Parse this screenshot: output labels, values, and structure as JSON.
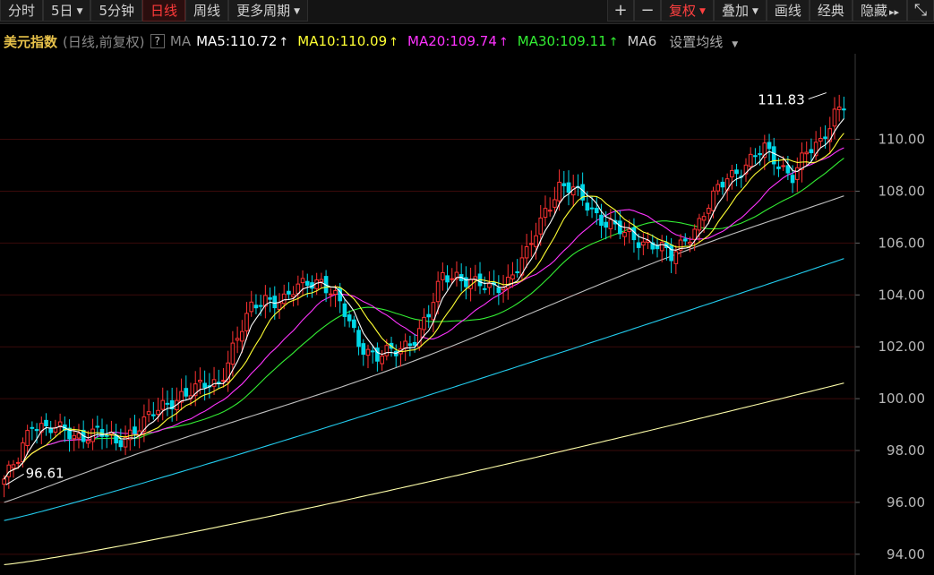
{
  "toolbar": {
    "tabs": [
      {
        "label": "分时",
        "active": false,
        "dropdown": false
      },
      {
        "label": "5日",
        "active": false,
        "dropdown": true
      },
      {
        "label": "5分钟",
        "active": false,
        "dropdown": false
      },
      {
        "label": "日线",
        "active": true,
        "dropdown": false
      },
      {
        "label": "周线",
        "active": false,
        "dropdown": false
      },
      {
        "label": "更多周期",
        "active": false,
        "dropdown": true
      }
    ],
    "zoom_in": "+",
    "zoom_out": "−",
    "adjust_label": "复权",
    "overlay_label": "叠加",
    "draw_label": "画线",
    "classic_label": "经典",
    "hide_label": "隐藏",
    "hide_arrow": "▸▸",
    "fullscreen_icon": "⤡"
  },
  "legend": {
    "name": "美元指数",
    "sub": "(日线,前复权)",
    "question": "?",
    "ma_label": "MA",
    "ma_items": [
      {
        "label": "MA5:110.72",
        "arrow": "↑",
        "color": "#ffffff"
      },
      {
        "label": "MA10:110.09",
        "arrow": "↑",
        "color": "#ffff33"
      },
      {
        "label": "MA20:109.74",
        "arrow": "↑",
        "color": "#ff33ff"
      },
      {
        "label": "MA30:109.11",
        "arrow": "↑",
        "color": "#33ee33"
      },
      {
        "label": "MA6",
        "arrow": "",
        "color": "#cccccc"
      }
    ],
    "setting": "设置均线"
  },
  "colors": {
    "up": "#ff3232",
    "down": "#00d8e8",
    "grid": "#3a0a0a",
    "ma5": "#ffffff",
    "ma10": "#ffff33",
    "ma20": "#ff33ff",
    "ma30": "#33ee33",
    "ma60": "#c0c0c0",
    "ma120": "#22ccee",
    "ma250": "#ffffaa"
  },
  "chart_data": {
    "type": "candlestick",
    "title": "美元指数",
    "ylim": [
      93.2,
      113.3
    ],
    "y_ticks": [
      94.0,
      96.0,
      98.0,
      100.0,
      102.0,
      104.0,
      106.0,
      108.0,
      110.0
    ],
    "y_tick_labels": [
      "94.00",
      "96.00",
      "98.00",
      "100.00",
      "102.00",
      "104.00",
      "106.00",
      "108.00",
      "110.00"
    ],
    "grid": true,
    "annotations": [
      {
        "label": "111.83",
        "value": 111.83,
        "kind": "high"
      },
      {
        "label": "96.61",
        "value": 96.61,
        "kind": "low"
      }
    ],
    "close_anchors": [
      [
        0,
        96.9
      ],
      [
        3,
        97.6
      ],
      [
        6,
        99.1
      ],
      [
        10,
        98.9
      ],
      [
        15,
        98.5
      ],
      [
        20,
        98.8
      ],
      [
        24,
        98.2
      ],
      [
        28,
        98.9
      ],
      [
        33,
        99.5
      ],
      [
        38,
        100.2
      ],
      [
        42,
        100.4
      ],
      [
        46,
        100.6
      ],
      [
        49,
        102.0
      ],
      [
        53,
        103.4
      ],
      [
        56,
        103.9
      ],
      [
        60,
        103.8
      ],
      [
        65,
        104.5
      ],
      [
        68,
        104.6
      ],
      [
        72,
        103.6
      ],
      [
        76,
        102.2
      ],
      [
        80,
        101.6
      ],
      [
        84,
        101.8
      ],
      [
        88,
        102.4
      ],
      [
        91,
        103.2
      ],
      [
        94,
        104.7
      ],
      [
        97,
        104.8
      ],
      [
        101,
        104.4
      ],
      [
        104,
        104.2
      ],
      [
        108,
        104.6
      ],
      [
        112,
        105.5
      ],
      [
        116,
        107.3
      ],
      [
        119,
        108.2
      ],
      [
        122,
        108.0
      ],
      [
        125,
        107.5
      ],
      [
        129,
        106.8
      ],
      [
        133,
        106.3
      ],
      [
        137,
        106.1
      ],
      [
        140,
        105.9
      ],
      [
        143,
        105.4
      ],
      [
        146,
        106.2
      ],
      [
        149,
        106.8
      ],
      [
        152,
        107.7
      ],
      [
        155,
        108.6
      ],
      [
        158,
        108.9
      ],
      [
        161,
        109.3
      ],
      [
        163,
        109.6
      ],
      [
        166,
        109.1
      ],
      [
        169,
        108.6
      ],
      [
        172,
        109.4
      ],
      [
        175,
        109.9
      ],
      [
        178,
        111.1
      ],
      [
        180,
        111.3
      ]
    ],
    "ma_last_values": {
      "MA5": 110.72,
      "MA10": 110.09,
      "MA20": 109.74,
      "MA30": 109.11,
      "MA60": 107.9,
      "MA120": 105.4,
      "MA250": 100.6
    },
    "ma_first_values": {
      "MA120": 95.3,
      "MA250": 93.6
    }
  }
}
